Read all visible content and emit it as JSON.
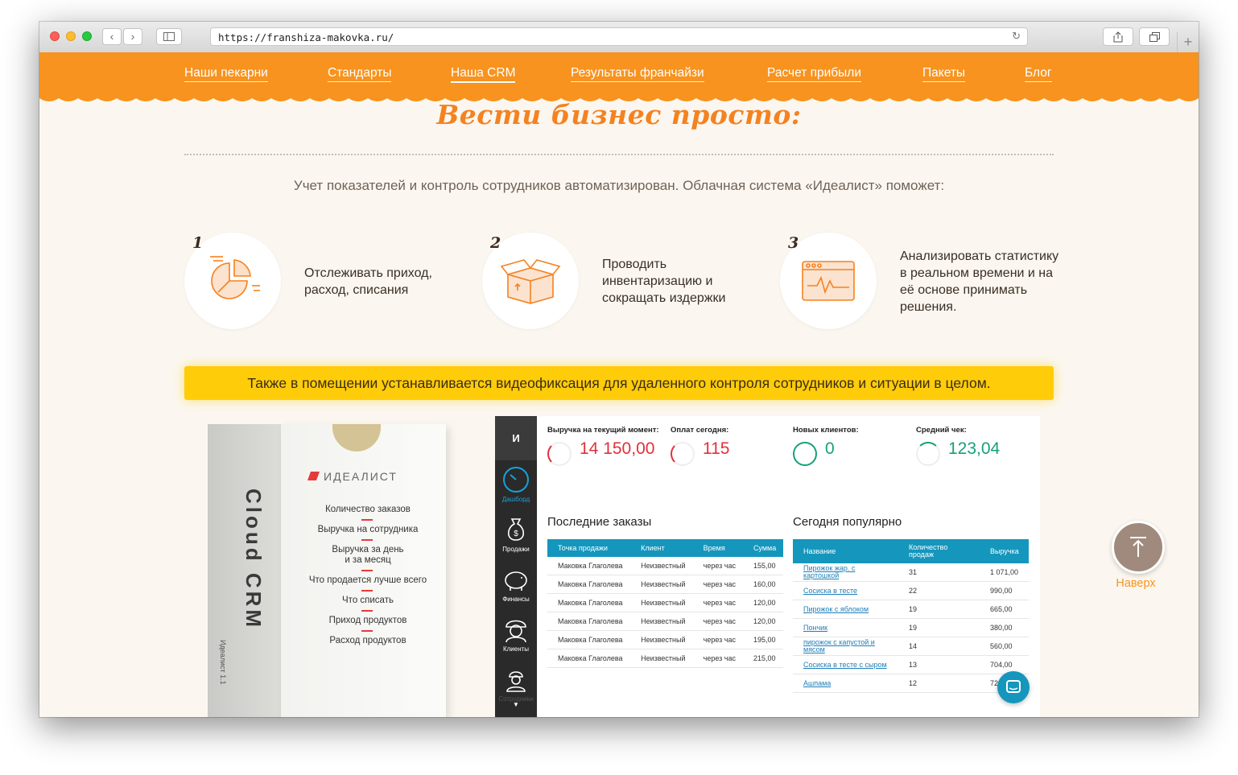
{
  "browser": {
    "url": "https://franshiza-makovka.ru/"
  },
  "nav": {
    "items": [
      "Наши пекарни",
      "Стандарты",
      "Наша CRM",
      "Результаты франчайзи",
      "Расчет прибыли",
      "Пакеты",
      "Блог"
    ],
    "active_index": 2
  },
  "headline": "Вести бизнес просто:",
  "intro": "Учет показателей и контроль сотрудников автоматизирован. Облачная система «Идеалист» поможет:",
  "features": [
    {
      "num": "1",
      "icon": "pie-chart-icon",
      "text": "Отслеживать приход, расход, списания"
    },
    {
      "num": "2",
      "icon": "box-icon",
      "text": "Проводить инвентаризацию и сокращать издержки"
    },
    {
      "num": "3",
      "icon": "analytics-icon",
      "text": "Анализировать статистику в реальном времени и на её основе принимать решения."
    }
  ],
  "banner": "Также в помещении устанавливается видеофиксация для удаленного контроля сотрудников и ситуации в целом.",
  "product_box": {
    "logo": "ИДЕАЛИСТ",
    "side_text": "Cloud CRM",
    "small_text": "Идеалист 1.1",
    "list": [
      "Количество заказов",
      "Выручка на сотрудника",
      "Выручка за день\nи за месяц",
      "Что продается лучше всего",
      "Что списать",
      "Приход продуктов",
      "Расход продуктов"
    ]
  },
  "dashboard": {
    "logo": "И",
    "sidebar": [
      {
        "label": "Дашборд",
        "icon": "speedometer-icon"
      },
      {
        "label": "Продажи",
        "icon": "money-bag-icon"
      },
      {
        "label": "Финансы",
        "icon": "piggy-bank-icon"
      },
      {
        "label": "Клиенты",
        "icon": "client-icon"
      },
      {
        "label": "Сотрудники",
        "icon": "worker-icon"
      }
    ],
    "metrics": [
      {
        "label": "Выручка на текущий момент:",
        "value": "14 150,00",
        "color": "#e2303b"
      },
      {
        "label": "Оплат сегодня:",
        "value": "115",
        "color": "#e2303b"
      },
      {
        "label": "Новых клиентов:",
        "value": "0",
        "color": "#17a07a"
      },
      {
        "label": "Средний чек:",
        "value": "123,04",
        "color": "#17a07a"
      }
    ],
    "orders": {
      "title": "Последние заказы",
      "headers": [
        "Точка продажи",
        "Клиент",
        "Время",
        "Сумма"
      ],
      "rows": [
        [
          "Маковка Глаголева",
          "Неизвестный",
          "через час",
          "155,00"
        ],
        [
          "Маковка Глаголева",
          "Неизвестный",
          "через час",
          "160,00"
        ],
        [
          "Маковка Глаголева",
          "Неизвестный",
          "через час",
          "120,00"
        ],
        [
          "Маковка Глаголева",
          "Неизвестный",
          "через час",
          "120,00"
        ],
        [
          "Маковка Глаголева",
          "Неизвестный",
          "через час",
          "195,00"
        ],
        [
          "Маковка Глаголева",
          "Неизвестный",
          "через час",
          "215,00"
        ]
      ]
    },
    "popular": {
      "title": "Сегодня популярно",
      "headers": [
        "Название",
        "Количество продаж",
        "Выручка"
      ],
      "rows": [
        [
          "Пирожок жар. с картошкой",
          "31",
          "1 071,00"
        ],
        [
          "Сосиска в тесте",
          "22",
          "990,00"
        ],
        [
          "Пирожок с яблоком",
          "19",
          "665,00"
        ],
        [
          "Пончик",
          "19",
          "380,00"
        ],
        [
          "пирожок с капустой и мясом",
          "14",
          "560,00"
        ],
        [
          "Сосиска в тесте с сыром",
          "13",
          "704,00"
        ],
        [
          "Ашпама",
          "12",
          "720,00"
        ]
      ]
    }
  },
  "back_to_top": "Наверх",
  "colors": {
    "nav_orange": "#f7931e",
    "headline_orange": "#f58220",
    "banner_yellow": "#ffcc0a",
    "table_header": "#1596bd"
  }
}
